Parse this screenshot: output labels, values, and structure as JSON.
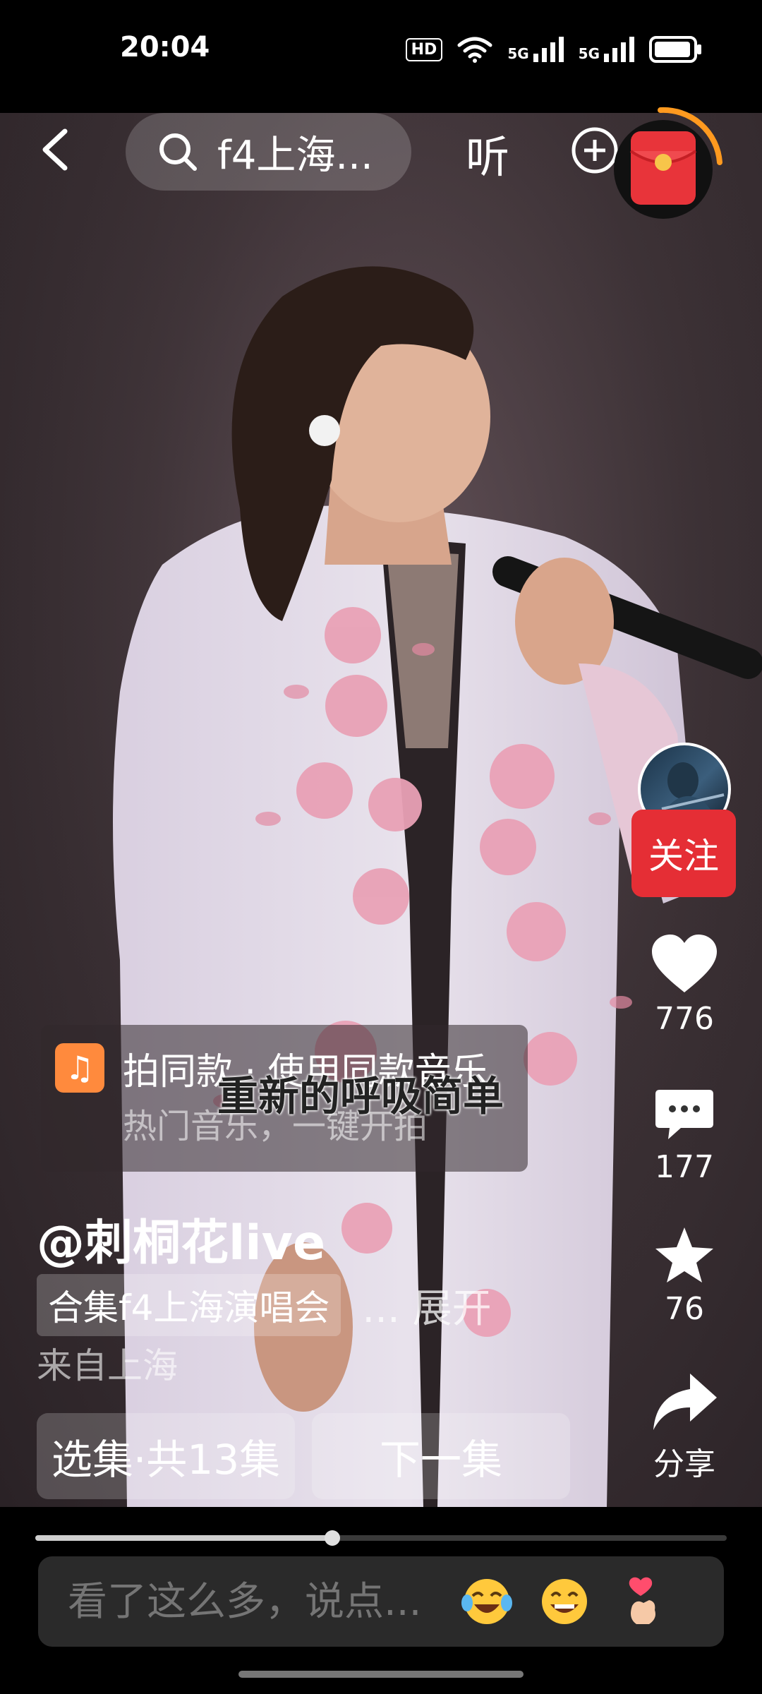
{
  "status": {
    "time": "20:04",
    "hd": "HD",
    "net1": "5G",
    "net2": "5G"
  },
  "topbar": {
    "search_query": "f4上海...",
    "listen_label": "听"
  },
  "actions": {
    "follow_label": "关注",
    "likes": "776",
    "comments": "177",
    "favorites": "76",
    "share_label": "分享"
  },
  "music": {
    "title": "拍同款 · 使用同款音乐",
    "subtitle": "热门音乐，一键开拍",
    "lyric": "重新的呼吸简单"
  },
  "caption": {
    "author": "@刺桐花live",
    "collection": "合集f4上海演唱会",
    "expand": "... 展开",
    "location": "来自上海"
  },
  "episodes": {
    "select_label": "选集·共13集",
    "next_label": "下一集"
  },
  "player": {
    "progress": 0.43
  },
  "comment_box": {
    "placeholder": "看了这么多，说点..."
  },
  "icons": {
    "back": "chevron-left-icon",
    "search": "search-icon",
    "plus": "plus-circle-icon",
    "redpacket": "red-envelope-icon",
    "like": "heart-icon",
    "comment": "comment-icon",
    "favorite": "star-icon",
    "share": "share-arrow-icon",
    "music": "music-note-icon",
    "emoji_laugh": "laughing-tears-emoji",
    "emoji_grin": "grinning-emoji",
    "emoji_heart": "finger-heart-emoji"
  },
  "colors": {
    "follow": "#e52e35",
    "music_icon": "#ff8a3d",
    "redpacket": "#e8343a"
  }
}
